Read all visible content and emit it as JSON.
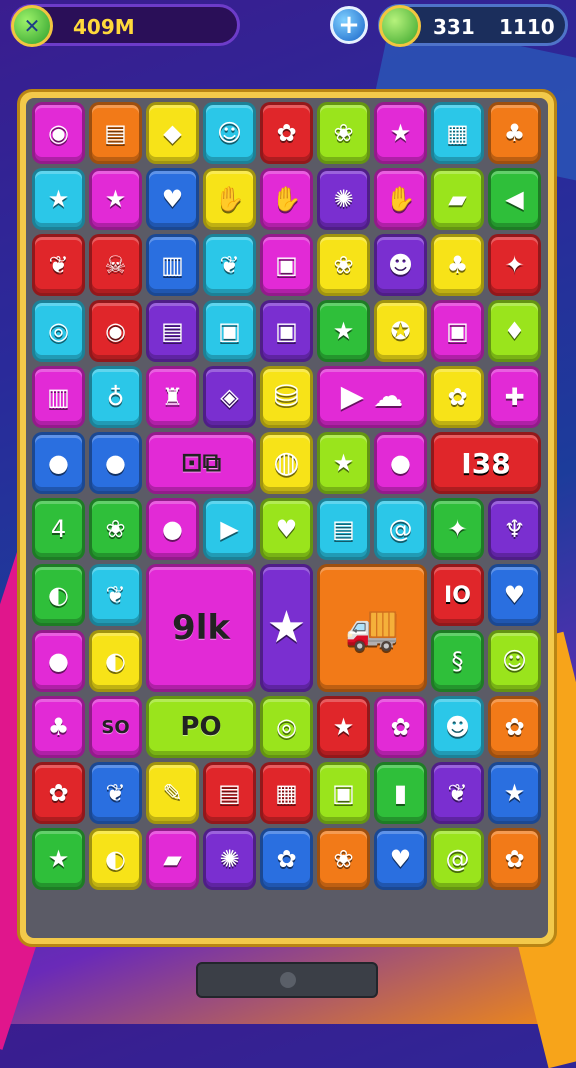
{
  "hud": {
    "left_value": "409M",
    "right_value_a": "331",
    "right_value_b": "1110"
  },
  "board": {
    "big_tiles": [
      {
        "name": "big-tile-label-1",
        "label": "⊡⧉"
      },
      {
        "name": "big-tile-label-2",
        "label": "I38"
      },
      {
        "name": "big-tile-label-3",
        "label": "9lk"
      },
      {
        "name": "big-tile-label-4",
        "label": "IO"
      },
      {
        "name": "big-tile-label-5",
        "label": "PO"
      },
      {
        "name": "big-tile-label-6",
        "label": "SO"
      }
    ]
  },
  "colors": {
    "magenta": "#e22ad6",
    "yellow": "#f7e318",
    "cyan": "#2bc7e8",
    "red": "#e0262a",
    "green": "#2fbf3a",
    "orange": "#f27a18",
    "purple": "#7a2fd0",
    "blue": "#2a6fe0",
    "lime": "#9ae41c"
  }
}
